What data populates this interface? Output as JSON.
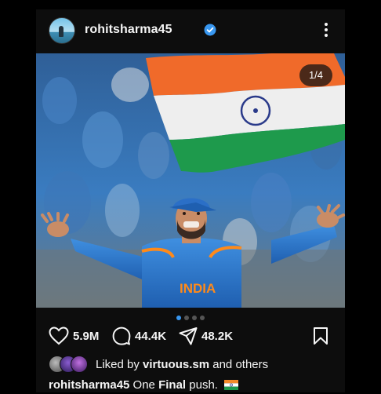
{
  "post": {
    "username": "rohitsharma45",
    "verified": true,
    "image_counter": "1/4",
    "carousel": {
      "count": 4,
      "active_index": 0
    },
    "likes": "5.9M",
    "comments": "44.4K",
    "shares": "48.2K",
    "liked_by_prefix": "Liked by",
    "liked_by_user": "virtuous.sm",
    "liked_by_suffix": "and others",
    "caption_user": "rohitsharma45",
    "caption_text_1": "One",
    "caption_text_2": "Final",
    "caption_text_3": "push.",
    "jersey_text": "INDIA"
  },
  "icons": {
    "verified": "verified-badge-icon",
    "more": "more-vertical-icon",
    "like": "heart-icon",
    "comment": "comment-icon",
    "share": "share-icon",
    "save": "bookmark-icon"
  },
  "colors": {
    "accent": "#3897f0",
    "verified": "#3897f0",
    "background": "#000000",
    "card": "#0d0d0d"
  }
}
